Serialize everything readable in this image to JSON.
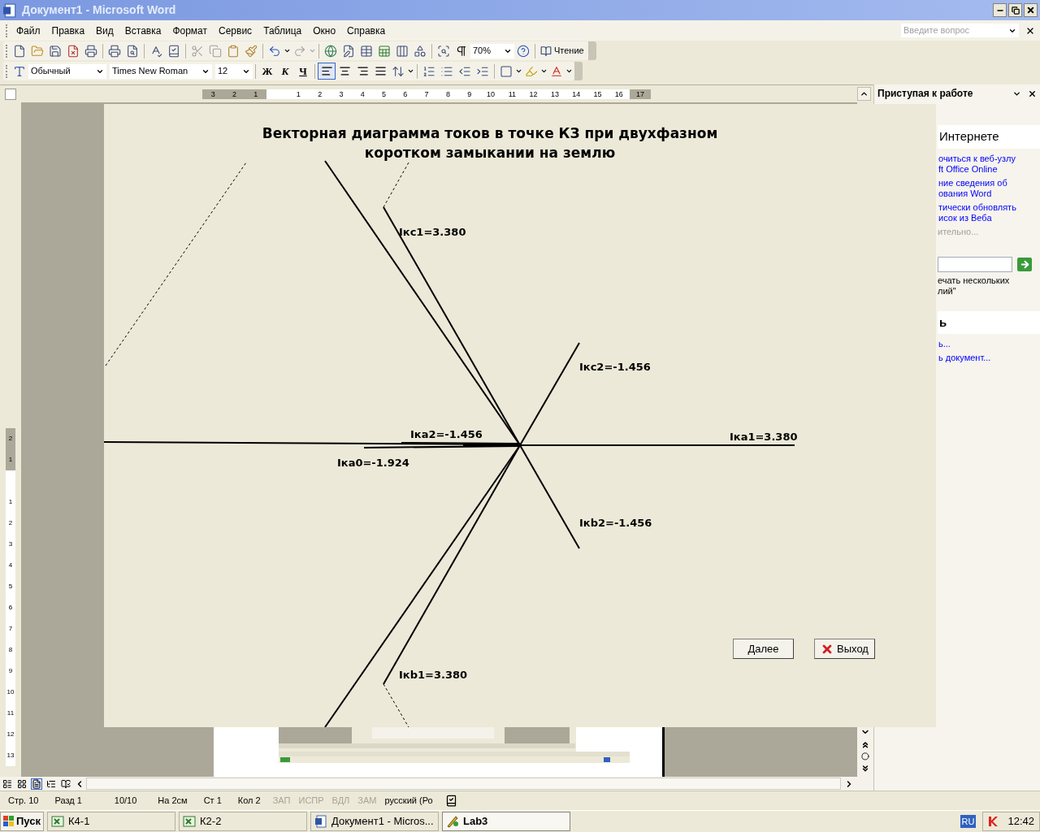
{
  "window": {
    "title": "Документ1 - Microsoft Word"
  },
  "menu": [
    "Файл",
    "Правка",
    "Вид",
    "Вставка",
    "Формат",
    "Сервис",
    "Таблица",
    "Окно",
    "Справка"
  ],
  "help_box": {
    "placeholder": "Введите вопрос"
  },
  "standard_toolbar": {
    "zoom": "70%",
    "reading_button": "Чтение"
  },
  "formatting_toolbar": {
    "style": "Обычный",
    "font": "Times New Roman",
    "size": "12",
    "bold": "Ж",
    "italic": "К",
    "underline": "Ч",
    "alignments": [
      {
        "selected": true
      },
      {
        "selected": false
      },
      {
        "selected": false
      },
      {
        "selected": false
      }
    ]
  },
  "ruler": {
    "marks": [
      {
        "label": "3",
        "shaded": true
      },
      {
        "label": "2",
        "shaded": true
      },
      {
        "label": "1",
        "shaded": true
      },
      {
        "label": "1",
        "shaded": false
      },
      {
        "label": "2",
        "shaded": false
      },
      {
        "label": "3",
        "shaded": false
      },
      {
        "label": "4",
        "shaded": false
      },
      {
        "label": "5",
        "shaded": false
      },
      {
        "label": "6",
        "shaded": false
      },
      {
        "label": "7",
        "shaded": false
      },
      {
        "label": "8",
        "shaded": false
      },
      {
        "label": "9",
        "shaded": false
      },
      {
        "label": "10",
        "shaded": false
      },
      {
        "label": "11",
        "shaded": false
      },
      {
        "label": "12",
        "shaded": false
      },
      {
        "label": "13",
        "shaded": false
      },
      {
        "label": "14",
        "shaded": false
      },
      {
        "label": "15",
        "shaded": false
      },
      {
        "label": "16",
        "shaded": false
      },
      {
        "label": "17",
        "shaded": true
      }
    ]
  },
  "vertical_ruler": {
    "marks": [
      {
        "label": "2",
        "shaded": true
      },
      {
        "label": "1",
        "shaded": true
      },
      {
        "label": "1",
        "shaded": false
      },
      {
        "label": "2",
        "shaded": false
      },
      {
        "label": "3",
        "shaded": false
      },
      {
        "label": "4",
        "shaded": false
      },
      {
        "label": "5",
        "shaded": false
      },
      {
        "label": "6",
        "shaded": false
      },
      {
        "label": "7",
        "shaded": false
      },
      {
        "label": "8",
        "shaded": false
      },
      {
        "label": "9",
        "shaded": false
      },
      {
        "label": "10",
        "shaded": false
      },
      {
        "label": "11",
        "shaded": false
      },
      {
        "label": "12",
        "shaded": false
      },
      {
        "label": "13",
        "shaded": false
      }
    ]
  },
  "task_pane": {
    "title": "Приступая к работе",
    "items": [
      {
        "kind": "heading",
        "lines": [
          "Интернете"
        ]
      },
      {
        "kind": "link",
        "lines": [
          "очиться к веб-узлу",
          "ft Office Online"
        ]
      },
      {
        "kind": "link",
        "lines": [
          "ние сведения об",
          "ования Word"
        ]
      },
      {
        "kind": "link",
        "lines": [
          "тически обновлять",
          "исок из Веба"
        ]
      },
      {
        "kind": "muted",
        "lines": [
          "ительно..."
        ]
      },
      {
        "kind": "field"
      },
      {
        "kind": "text",
        "lines": [
          "ечать нескольких",
          "лий\""
        ]
      },
      {
        "kind": "heading",
        "lines": [
          "ь"
        ]
      },
      {
        "kind": "link",
        "lines": [
          "ь..."
        ]
      },
      {
        "kind": "link",
        "lines": [
          "ь документ..."
        ]
      }
    ]
  },
  "lab3": {
    "title_lines": [
      "Векторная диаграмма токов в точке КЗ при двухфазном",
      "коротком замыкании на землю"
    ],
    "vector_labels": [
      "Iкс1=3.380",
      "Iкс2=-1.456",
      "Iка2=-1.456",
      "Iка1=3.380",
      "Iка0=-1.924",
      "Iкb2=-1.456",
      "Iкb1=3.380"
    ],
    "buttons": [
      {
        "label": "Далее",
        "kind": "plain"
      },
      {
        "label": "Выход",
        "kind": "exit"
      }
    ]
  },
  "status_bar": {
    "fields": [
      {
        "text": "Стр. 10",
        "disabled": false
      },
      {
        "text": "Разд 1",
        "disabled": false
      },
      {
        "text": "10/10",
        "disabled": false
      },
      {
        "text": "На 2см",
        "disabled": false
      },
      {
        "text": "Ст 1",
        "disabled": false
      },
      {
        "text": "Кол 2",
        "disabled": false
      },
      {
        "text": "ЗАП",
        "disabled": true
      },
      {
        "text": "ИСПР",
        "disabled": true
      },
      {
        "text": "ВДЛ",
        "disabled": true
      },
      {
        "text": "ЗАМ",
        "disabled": true
      },
      {
        "text": "русский (Ро",
        "disabled": false
      }
    ]
  },
  "taskbar": {
    "start": "Пуск",
    "items": [
      {
        "label": "К4-1",
        "kind": "excel",
        "selected": false
      },
      {
        "label": "К2-2",
        "kind": "excel",
        "selected": false
      },
      {
        "label": "Документ1 - Micros...",
        "kind": "word",
        "selected": false
      },
      {
        "label": "Lab3",
        "kind": "app",
        "selected": true
      }
    ],
    "language": "RU",
    "clock": "12:42"
  }
}
